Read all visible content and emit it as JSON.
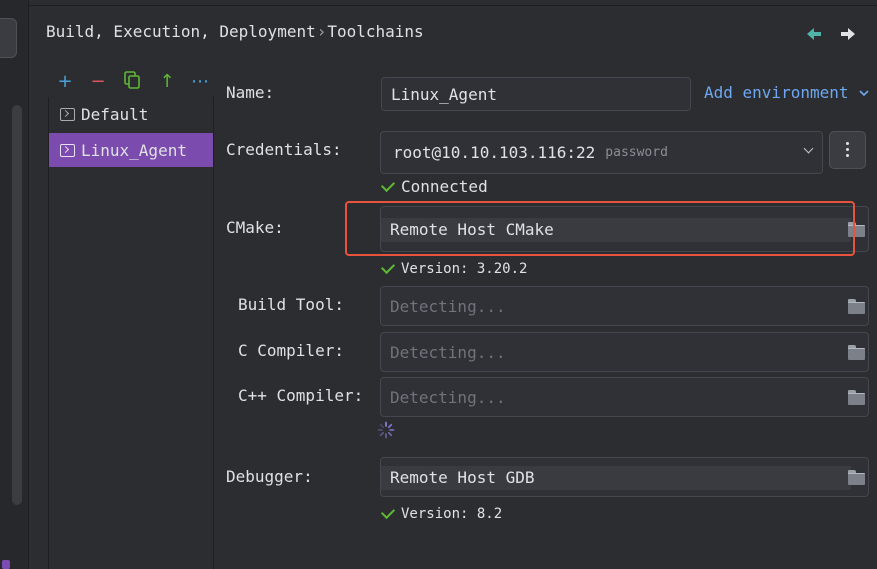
{
  "breadcrumb": {
    "parent": "Build, Execution, Deployment",
    "separator": "›",
    "current": "Toolchains"
  },
  "nav": {
    "back_icon": "arrow-left-icon",
    "forward_icon": "arrow-right-icon"
  },
  "toolbar": {
    "add": "+",
    "remove": "−",
    "copy_icon": "copy-icon",
    "up": "↑",
    "more": "⋯"
  },
  "toolchains": [
    {
      "label": "Default",
      "selected": false
    },
    {
      "label": "Linux_Agent",
      "selected": true
    }
  ],
  "form": {
    "name": {
      "label": "Name:",
      "value": "Linux_Agent"
    },
    "add_environment": "Add environment",
    "credentials": {
      "label": "Credentials:",
      "value": "root@10.10.103.116:22",
      "auth": "password"
    },
    "connection_status": "Connected",
    "cmake": {
      "label": "CMake:",
      "value": "Remote Host CMake",
      "version": "Version: 3.20.2"
    },
    "build_tool": {
      "label": "Build Tool:",
      "placeholder": "Detecting..."
    },
    "c_compiler": {
      "label": "C Compiler:",
      "placeholder": "Detecting..."
    },
    "cxx_compiler": {
      "label": "C++ Compiler:",
      "placeholder": "Detecting..."
    },
    "debugger": {
      "label": "Debugger:",
      "value": "Remote Host GDB",
      "version": "Version: 8.2"
    }
  },
  "colors": {
    "background": "#2b2d30",
    "selection": "#7b4cad",
    "link": "#6ea8f2",
    "success": "#5fb832",
    "highlight_box": "#e8533d"
  }
}
